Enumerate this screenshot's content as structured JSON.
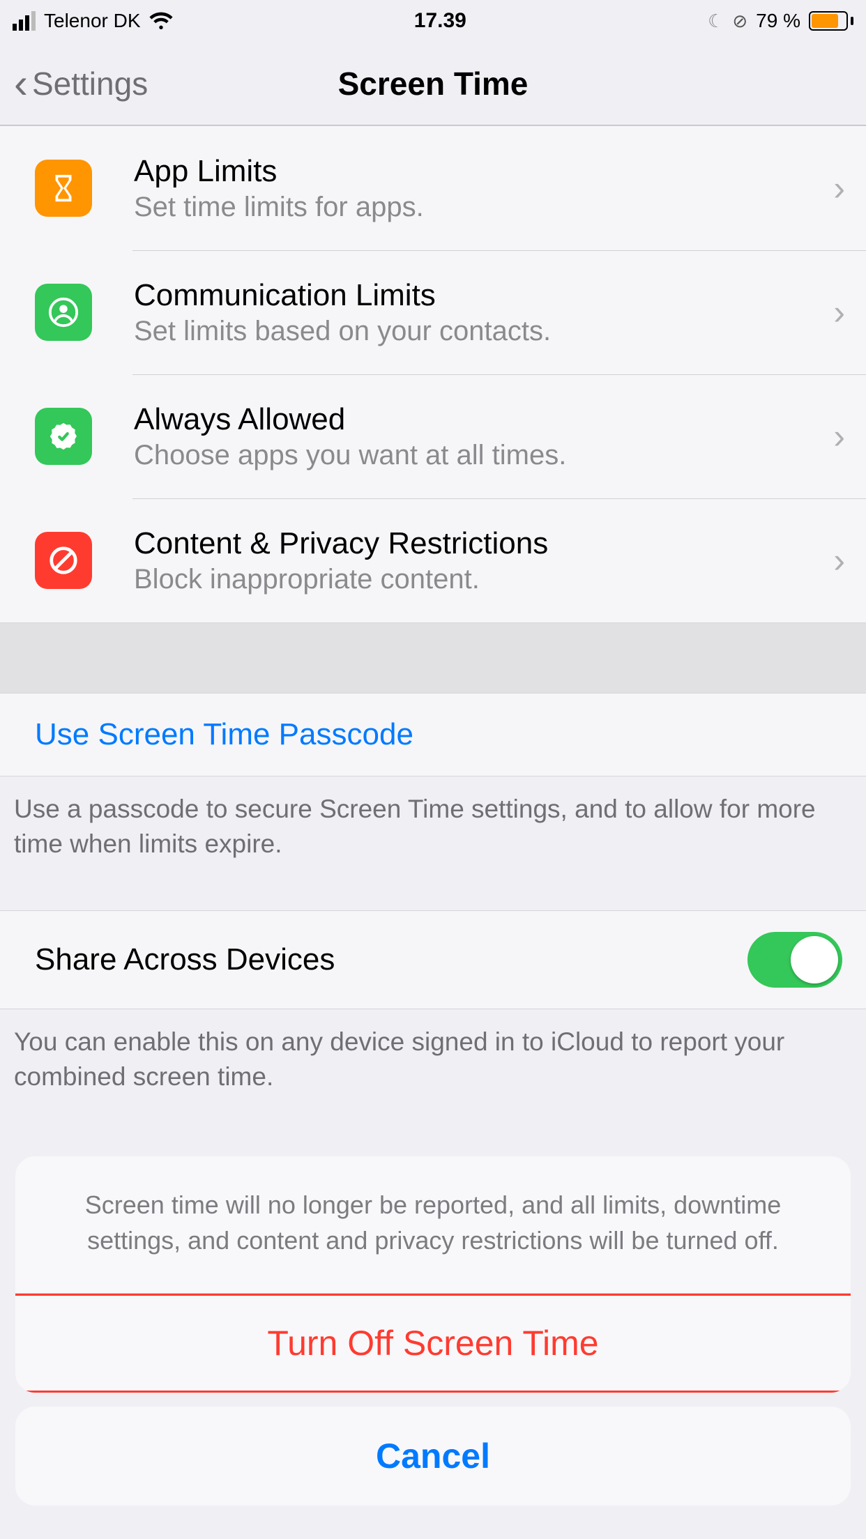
{
  "status": {
    "carrier": "Telenor DK",
    "time": "17.39",
    "battery_pct": "79 %"
  },
  "nav": {
    "back_label": "Settings",
    "title": "Screen Time"
  },
  "rows": {
    "app_limits": {
      "title": "App Limits",
      "sub": "Set time limits for apps."
    },
    "comm_limits": {
      "title": "Communication Limits",
      "sub": "Set limits based on your contacts."
    },
    "always_allowed": {
      "title": "Always Allowed",
      "sub": "Choose apps you want at all times."
    },
    "content_privacy": {
      "title": "Content & Privacy Restrictions",
      "sub": "Block inappropriate content."
    }
  },
  "passcode": {
    "link": "Use Screen Time Passcode",
    "footer": "Use a passcode to secure Screen Time settings, and to allow for more time when limits expire."
  },
  "share": {
    "title": "Share Across Devices",
    "footer": "You can enable this on any device signed in to iCloud to report your combined screen time."
  },
  "sheet": {
    "message": "Screen time will no longer be reported, and all limits, downtime settings, and content and privacy restrictions will be turned off.",
    "turn_off": "Turn Off Screen Time",
    "cancel": "Cancel"
  }
}
